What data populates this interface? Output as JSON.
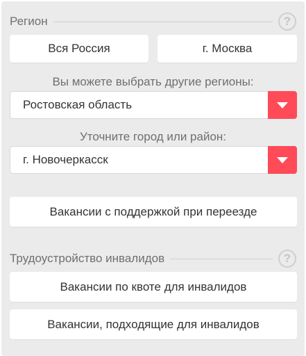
{
  "region": {
    "title": "Регион",
    "help": "?",
    "all_russia": "Вся Россия",
    "moscow": "г. Москва",
    "other_regions_label": "Вы можете выбрать другие регионы:",
    "region_value": "Ростовская область",
    "city_label": "Уточните город или район:",
    "city_value": "г. Новочеркасск",
    "relocation_button": "Вакансии с поддержкой при переезде"
  },
  "disabled": {
    "title": "Трудоустройство инвалидов",
    "help": "?",
    "quota_button": "Вакансии по квоте для инвалидов",
    "suitable_button": "Вакансии, подходящие для инвалидов"
  },
  "colors": {
    "accent": "#ff4b58",
    "panel_bg": "#ebebeb"
  }
}
